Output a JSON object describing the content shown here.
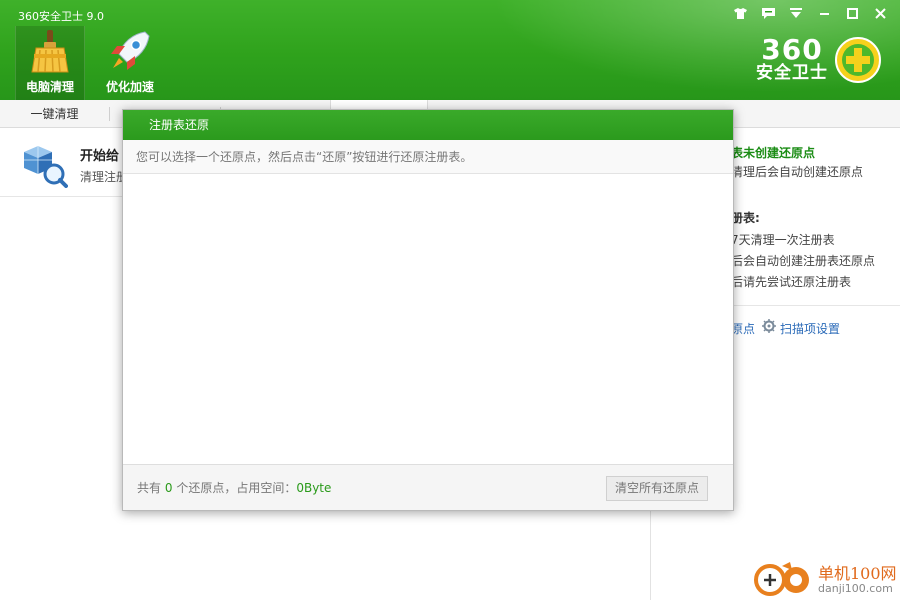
{
  "app": {
    "title": "360安全卫士 9.0"
  },
  "window_controls": [
    "shirt-icon",
    "feedback-icon",
    "menu-icon",
    "minimize-icon",
    "maximize-icon",
    "close-icon"
  ],
  "nav": [
    {
      "label": "电脑清理",
      "icon": "broom-icon",
      "active": true
    },
    {
      "label": "优化加速",
      "icon": "rocket-icon",
      "active": false
    }
  ],
  "logo": {
    "number": "360",
    "subtitle": "安全卫士"
  },
  "tabs": {
    "first": "一键清理"
  },
  "background": {
    "heading": "开始给",
    "subtext": "清理注册"
  },
  "right_panel": {
    "status": "表未创建还原点",
    "status_detail": "清理后会自动创建还原点",
    "tips_title": "册表:",
    "tips": [
      "7天清理一次注册表",
      "后会自动创建注册表还原点",
      "后请先尝试还原注册表"
    ],
    "link_restore": "原点",
    "link_settings": "扫描项设置"
  },
  "dialog": {
    "title": "注册表还原",
    "hint": "您可以选择一个还原点，然后点击“还原”按钮进行还原注册表。",
    "stats_prefix": "共有",
    "restore_count": "0",
    "stats_middle": "个还原点，占用空间：",
    "space_used": "0Byte",
    "clear_button": "清空所有还原点"
  },
  "watermark": {
    "name": "单机100网",
    "url": "danji100.com"
  }
}
